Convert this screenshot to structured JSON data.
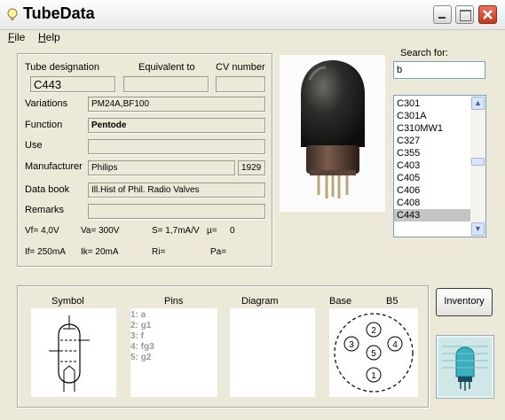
{
  "window": {
    "title": "TubeData",
    "app_icon": "lightbulb-icon"
  },
  "title_buttons": [
    "minimize-icon",
    "maximize-icon",
    "close-icon"
  ],
  "menu": [
    {
      "label": "File"
    },
    {
      "label": "Help"
    }
  ],
  "details": {
    "tube_designation_label": "Tube designation",
    "tube_designation": "C443",
    "equivalent_label": "Equivalent to",
    "equivalent": "",
    "cv_label": "CV number",
    "cv": "",
    "variations_label": "Variations",
    "variations": "PM24A,BF100",
    "function_label": "Function",
    "function": "Pentode",
    "use_label": "Use",
    "use": "",
    "manufacturer_label": "Manufacturer",
    "manufacturer": "Philips",
    "year": "1929",
    "databook_label": "Data book",
    "databook": "Ill.Hist of Phil. Radio Valves",
    "remarks_label": "Remarks",
    "remarks": ""
  },
  "specs": {
    "vf": "Vf= 4,0V",
    "va": "Va= 300V",
    "s": "S= 1,7mA/V",
    "mu": "µ=",
    "mu_value": "0",
    "if": "If= 250mA",
    "ik": "Ik= 20mA",
    "ri": "Ri=",
    "pa": "Pa="
  },
  "search": {
    "label": "Search for:",
    "value": "b",
    "results": [
      "C301",
      "C301A",
      "C310MW1",
      "C327",
      "C355",
      "C403",
      "C405",
      "C406",
      "C408",
      "C443"
    ],
    "selected": "C443"
  },
  "bottom": {
    "symbol_label": "Symbol",
    "pins_label": "Pins",
    "diagram_label": "Diagram",
    "base_label": "Base",
    "base_type": "B5",
    "pins": [
      "1: a",
      "2: g1",
      "3: f",
      "4: fg3",
      "5: g2"
    ],
    "base_pins": [
      "1",
      "2",
      "3",
      "4",
      "5"
    ]
  },
  "inventory_label": "Inventory"
}
